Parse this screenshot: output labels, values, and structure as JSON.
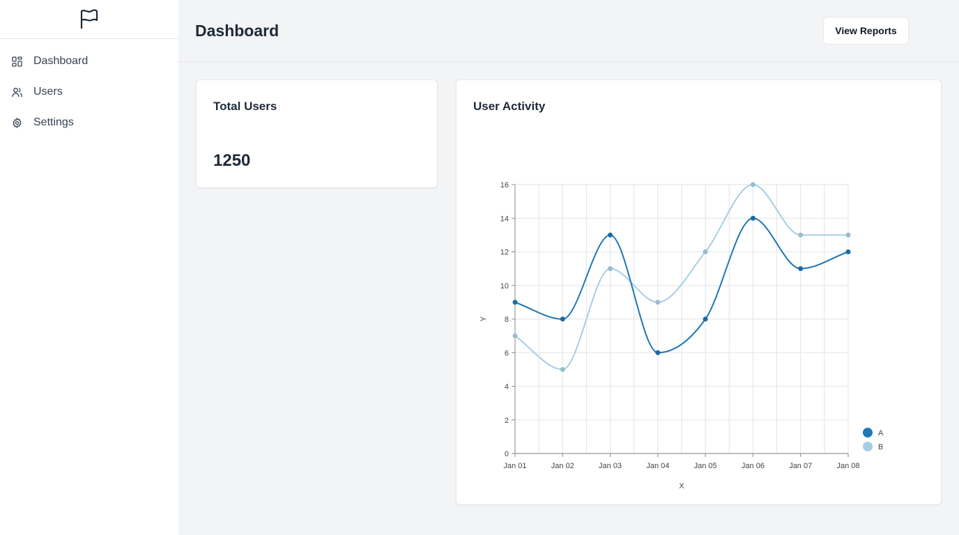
{
  "sidebar": {
    "logo_icon": "flag-icon",
    "items": [
      {
        "label": "Dashboard",
        "icon": "dashboard-grid-icon"
      },
      {
        "label": "Users",
        "icon": "users-icon"
      },
      {
        "label": "Settings",
        "icon": "gear-icon"
      }
    ]
  },
  "header": {
    "title": "Dashboard",
    "view_reports_label": "View Reports"
  },
  "total_users": {
    "title": "Total Users",
    "value": "1250"
  },
  "activity": {
    "title": "User Activity"
  },
  "chart_data": {
    "type": "line",
    "interpolation": "smooth",
    "xlabel": "X",
    "ylabel": "Y",
    "categories": [
      "Jan 01",
      "Jan 02",
      "Jan 03",
      "Jan 04",
      "Jan 05",
      "Jan 06",
      "Jan 07",
      "Jan 08"
    ],
    "ylim": [
      0,
      16
    ],
    "yticks": [
      0,
      2,
      4,
      6,
      8,
      10,
      12,
      14,
      16
    ],
    "grid": true,
    "legend": "bottom-right",
    "series": [
      {
        "name": "A",
        "color": "#1f77b4",
        "values": [
          9,
          8,
          13,
          6,
          8,
          14,
          11,
          12
        ]
      },
      {
        "name": "B",
        "color": "#a6cee3",
        "values": [
          7,
          5,
          11,
          9,
          12,
          16,
          13,
          13
        ]
      }
    ]
  }
}
